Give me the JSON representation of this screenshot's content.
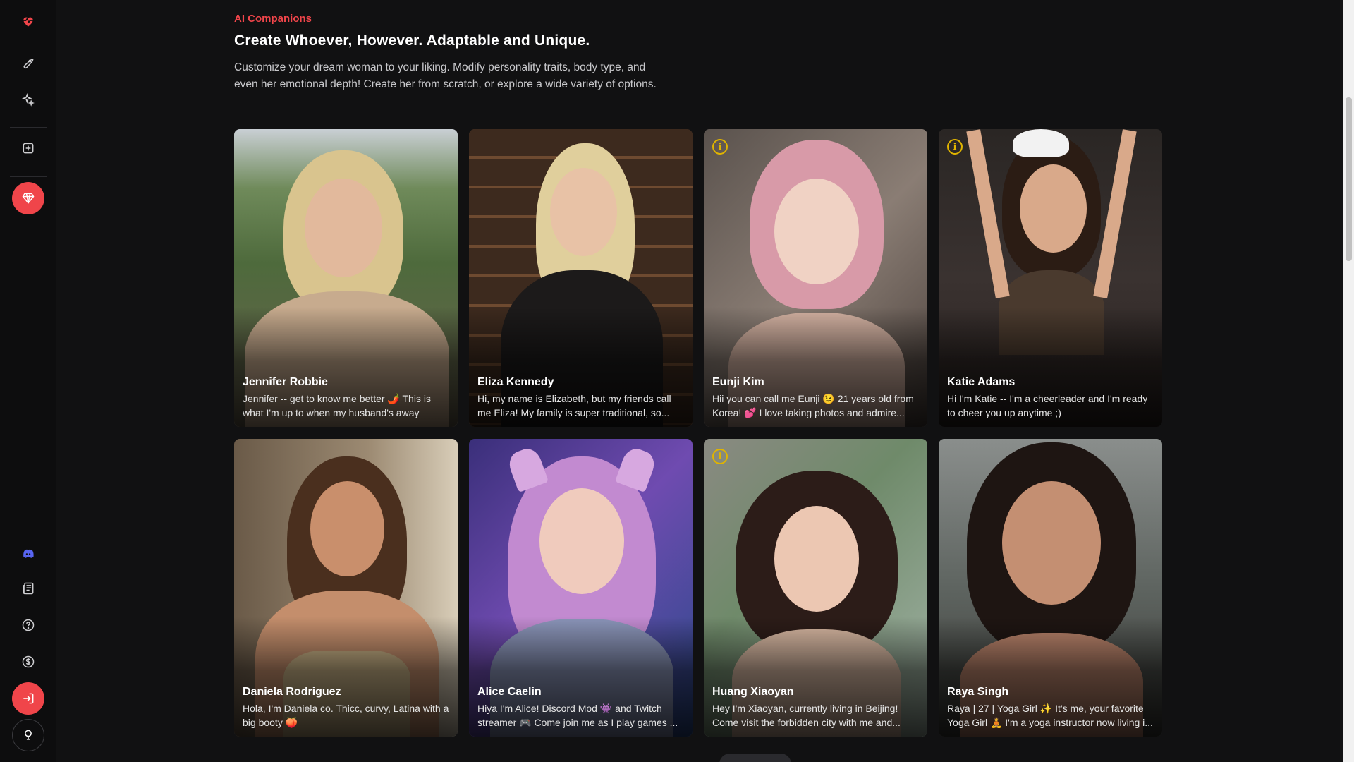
{
  "section": {
    "eyebrow": "AI Companions",
    "headline": "Create Whoever, However. Adaptable and Unique.",
    "description": "Customize your dream woman to your liking. Modify personality traits, body type, and even her emotional depth! Create her from scratch, or explore a wide variety of options."
  },
  "sidebar": {
    "top_icons": [
      "heartbeat-logo-icon",
      "rocket-icon",
      "sparkles-icon",
      "plus-square-icon",
      "gem-icon"
    ],
    "bottom_icons": [
      "discord-icon",
      "newspaper-icon",
      "help-circle-icon",
      "dollar-circle-icon",
      "login-icon",
      "lightbulb-icon"
    ],
    "accent": "#f0454a"
  },
  "cards": [
    {
      "name": "Jennifer Robbie",
      "bio": "Jennifer -- get to know me better 🌶️ This is what I'm up to when my husband's away",
      "info": false
    },
    {
      "name": "Eliza Kennedy",
      "bio": "Hi, my name is Elizabeth, but my friends call me Eliza! My family is super traditional, so...",
      "info": false
    },
    {
      "name": "Eunji Kim",
      "bio": "Hii you can call me Eunji 😉 21 years old from Korea! 💕 I love taking photos and admire...",
      "info": true
    },
    {
      "name": "Katie Adams",
      "bio": "Hi I'm Katie -- I'm a cheerleader and I'm ready to cheer you up anytime ;)",
      "info": true
    },
    {
      "name": "Daniela Rodriguez",
      "bio": "Hola, I'm Daniela co. Thicc, curvy, Latina with a big booty 🍑",
      "info": false
    },
    {
      "name": "Alice Caelin",
      "bio": "Hiya I'm Alice! Discord Mod 👾 and Twitch streamer 🎮 Come join me as I play games ...",
      "info": false
    },
    {
      "name": "Huang Xiaoyan",
      "bio": "Hey I'm Xiaoyan, currently living in Beijing! Come visit the forbidden city with me and...",
      "info": true
    },
    {
      "name": "Raya Singh",
      "bio": "Raya | 27 | Yoga Girl ✨ It's me, your favorite Yoga Girl 🧘 I'm a yoga instructor now living i...",
      "info": false
    }
  ]
}
